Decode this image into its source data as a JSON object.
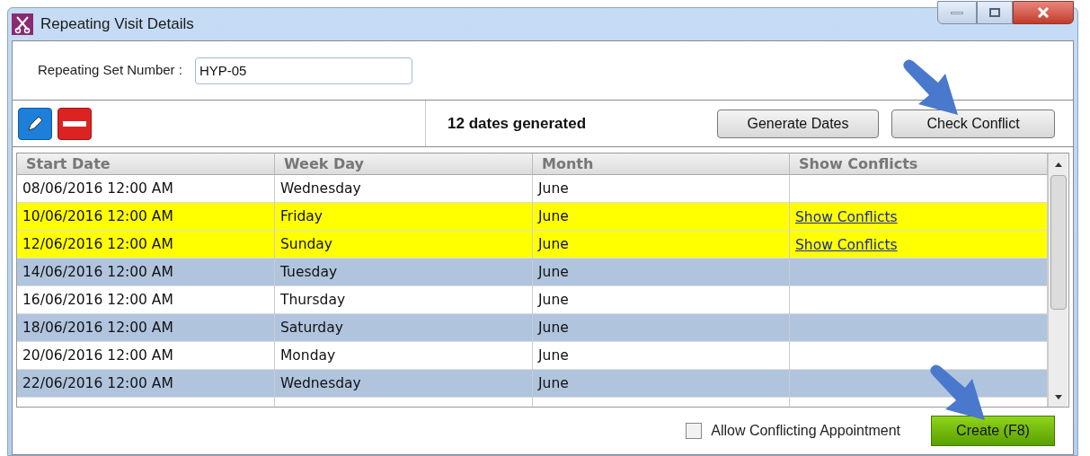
{
  "window": {
    "title": "Repeating Visit Details"
  },
  "set_number": {
    "label": "Repeating Set Number :",
    "value": "HYP-05"
  },
  "toolbar": {
    "status": "12 dates generated",
    "buttons": [
      "Generate Dates",
      "Check Conflict"
    ]
  },
  "table": {
    "columns": [
      "Start Date",
      "Week Day",
      "Month",
      "Show Conflicts"
    ],
    "rows": [
      {
        "start_date": "08/06/2016 12:00 AM",
        "week_day": "Wednesday",
        "month": "June",
        "kind": "plain"
      },
      {
        "start_date": "10/06/2016 12:00 AM",
        "week_day": "Friday",
        "month": "June",
        "kind": "conflict",
        "link": "Show Conflicts"
      },
      {
        "start_date": "12/06/2016 12:00 AM",
        "week_day": "Sunday",
        "month": "June",
        "kind": "conflict",
        "link": "Show Conflicts"
      },
      {
        "start_date": "14/06/2016 12:00 AM",
        "week_day": "Tuesday",
        "month": "June",
        "kind": "alternate"
      },
      {
        "start_date": "16/06/2016 12:00 AM",
        "week_day": "Thursday",
        "month": "June",
        "kind": "plain"
      },
      {
        "start_date": "18/06/2016 12:00 AM",
        "week_day": "Saturday",
        "month": "June",
        "kind": "alternate"
      },
      {
        "start_date": "20/06/2016 12:00 AM",
        "week_day": "Monday",
        "month": "June",
        "kind": "plain"
      },
      {
        "start_date": "22/06/2016 12:00 AM",
        "week_day": "Wednesday",
        "month": "June",
        "kind": "alternate"
      }
    ]
  },
  "footer": {
    "allow_conflicting": {
      "label": "Allow Conflicting Appointment",
      "checked": false
    },
    "create_button": "Create (F8)"
  }
}
